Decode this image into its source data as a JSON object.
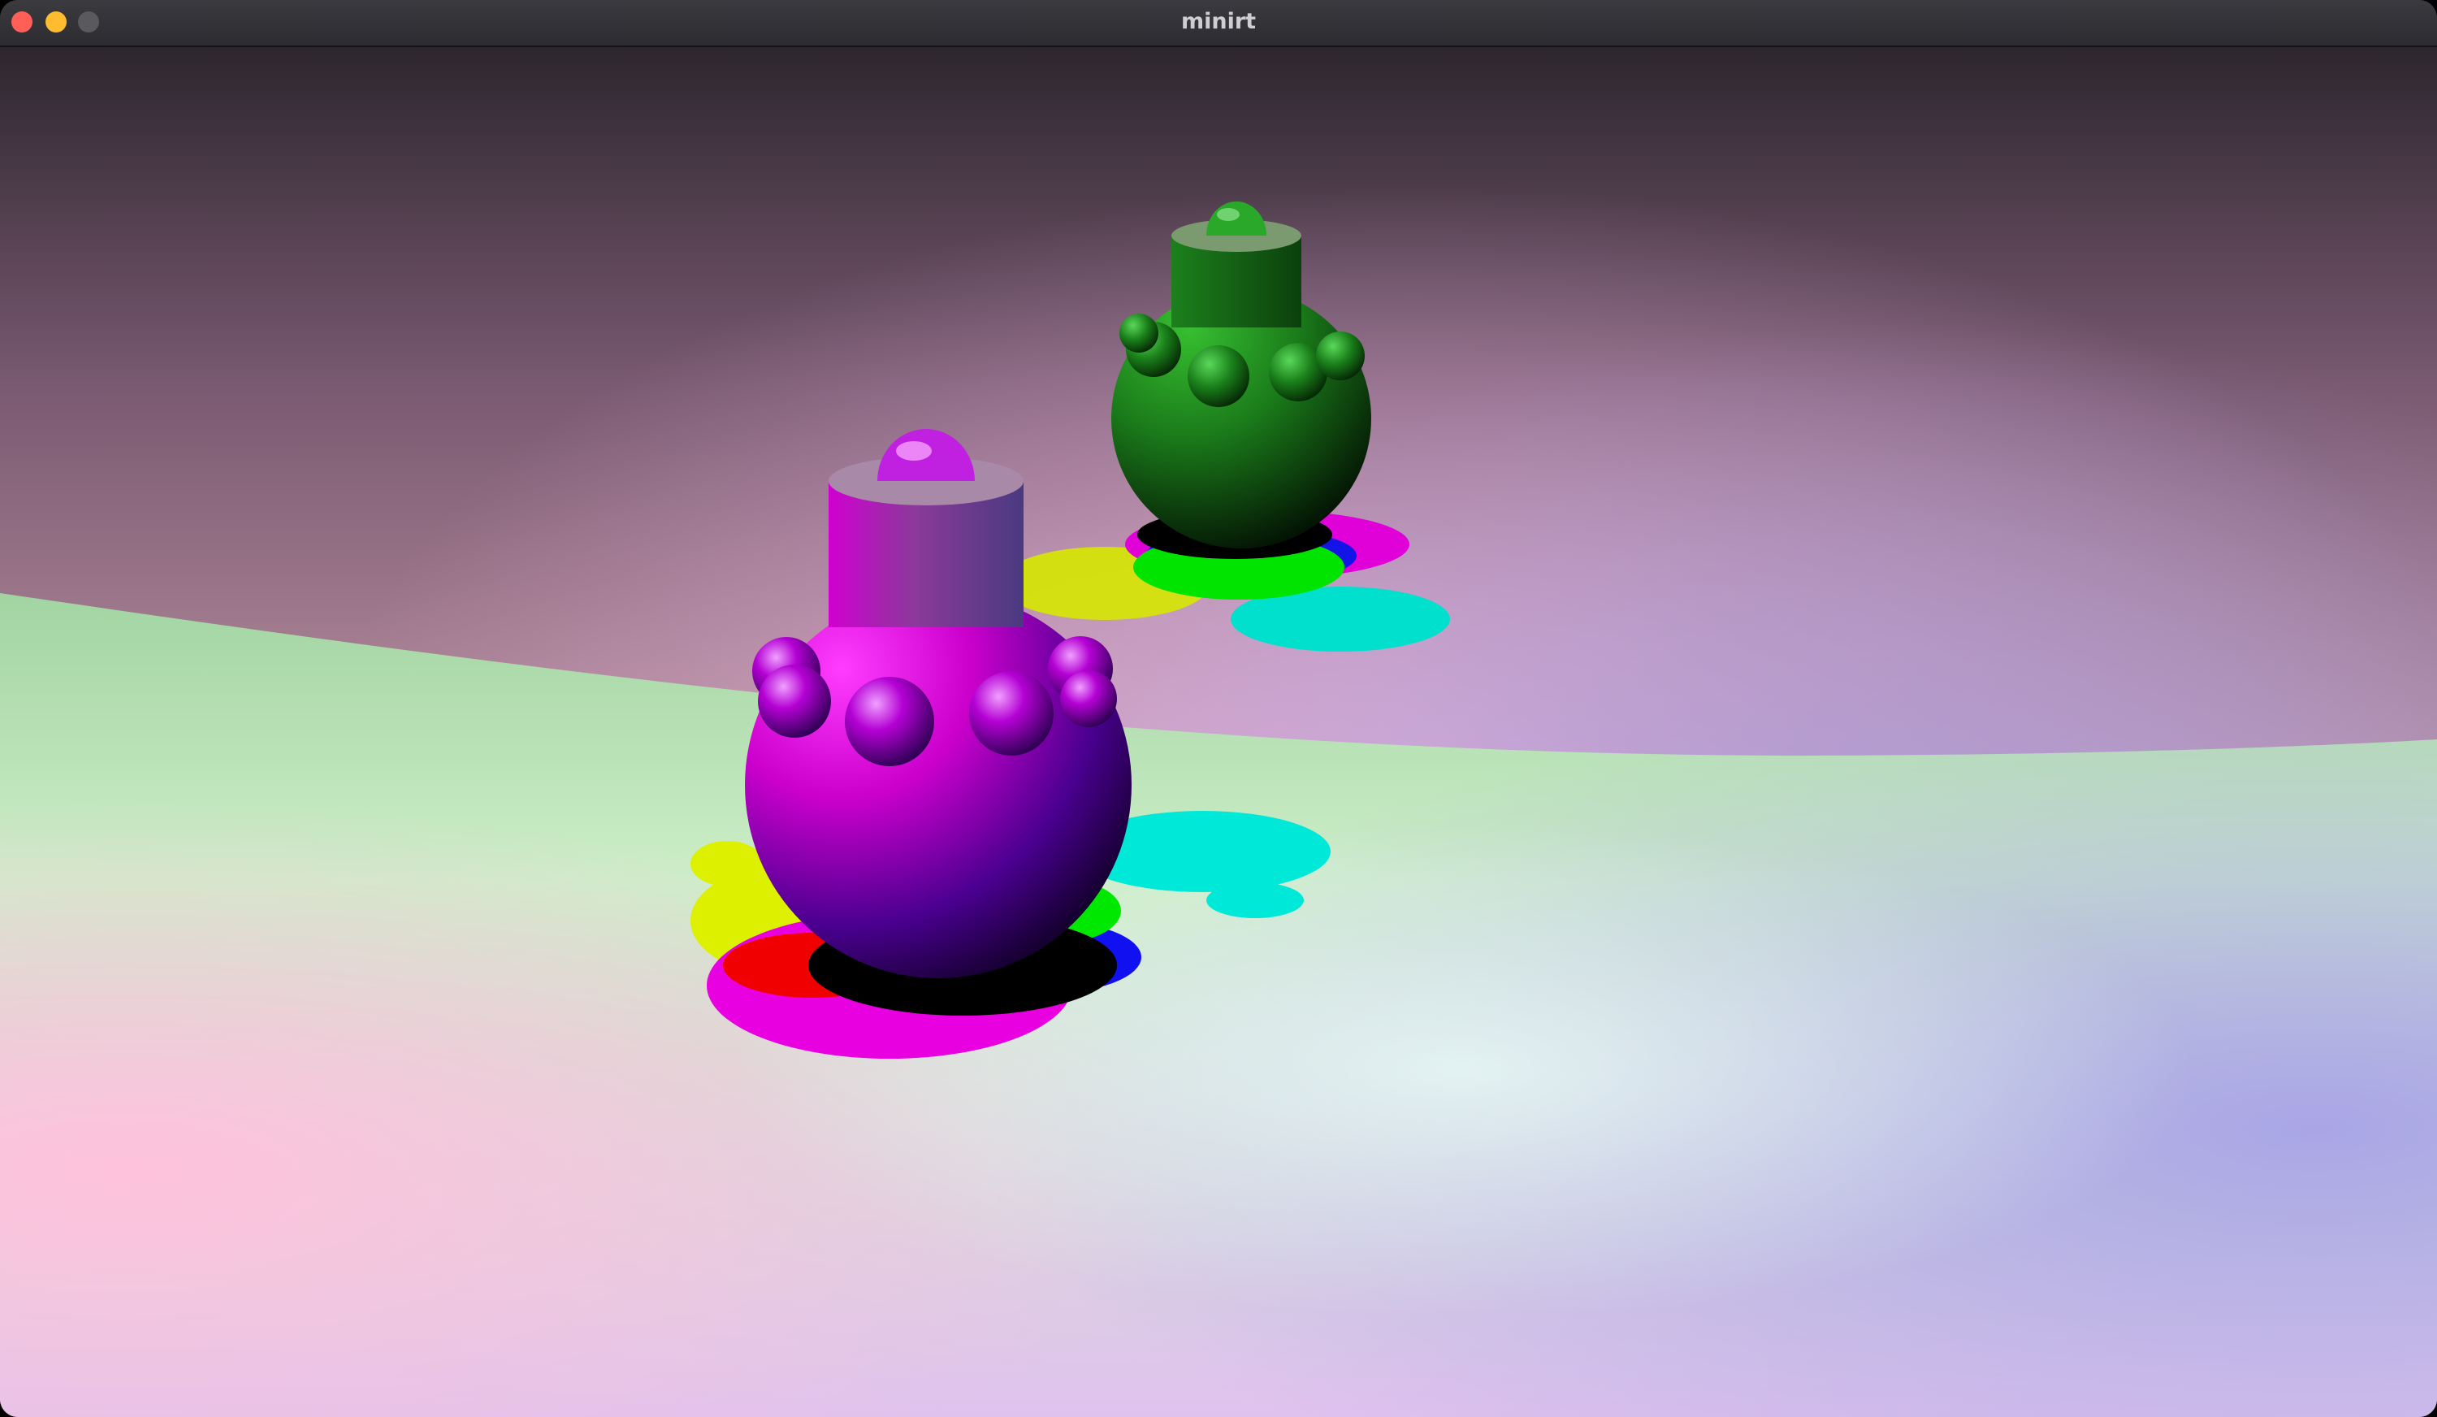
{
  "window": {
    "title": "minirt",
    "controls": [
      "close-button",
      "minimize-button",
      "maximize-button"
    ]
  },
  "colors": {
    "close": "#ff5f57",
    "minimize": "#febc2e",
    "maximize": "#5a5a5e",
    "titlebar": "#333338",
    "object_near": "#e000e8",
    "object_far": "#1e8a1e",
    "shadow_red": "#f00000",
    "shadow_magenta": "#e800e0",
    "shadow_yellow": "#dcf000",
    "shadow_cyan": "#00e8d8",
    "shadow_blue": "#1010f0",
    "shadow_green": "#00e800"
  },
  "render": {
    "objects": [
      "near-ornament",
      "far-ornament"
    ]
  }
}
